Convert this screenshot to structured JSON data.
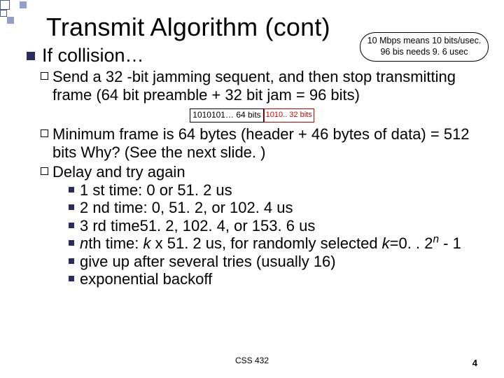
{
  "decor": {},
  "title": "Transmit Algorithm (cont)",
  "callout": {
    "line1": "10 Mbps means 10 bits/usec.",
    "line2": "96 bis needs 9. 6 usec"
  },
  "lvl1": "If collision…",
  "b1": {
    "lead": "Send",
    "rest": " a 32 -bit jamming sequent, and then stop transmitting frame (64 bit preamble + 32 bit jam = 96 bits)"
  },
  "diagram": {
    "preamble": "1010101… 64 bits",
    "jam": "1010.. 32 bits"
  },
  "b2": {
    "lead": "Minimum",
    "rest": " frame is 64 bytes (header + 46 bytes of data) = 512 bits Why? (See the next slide. )"
  },
  "b3": "Delay and try again",
  "delays": {
    "d1": "1 st time: 0 or 51. 2 us",
    "d2": "2 nd time: 0, 51. 2, or 102. 4 us",
    "d3": "3 rd time51. 2, 102. 4, or 153. 6 us",
    "d4_prefix_i": "n",
    "d4_mid": "th time: ",
    "d4_k": "k",
    "d4_times": " x 51. 2 us, for randomly selected ",
    "d4_keq": "k",
    "d4_range": "=0. . 2",
    "d4_exp_i": "n",
    "d4_tail": " - 1",
    "d5": "give up after several tries (usually 16)",
    "d6": "exponential backoff"
  },
  "footer": "CSS 432",
  "pagenum": "4"
}
